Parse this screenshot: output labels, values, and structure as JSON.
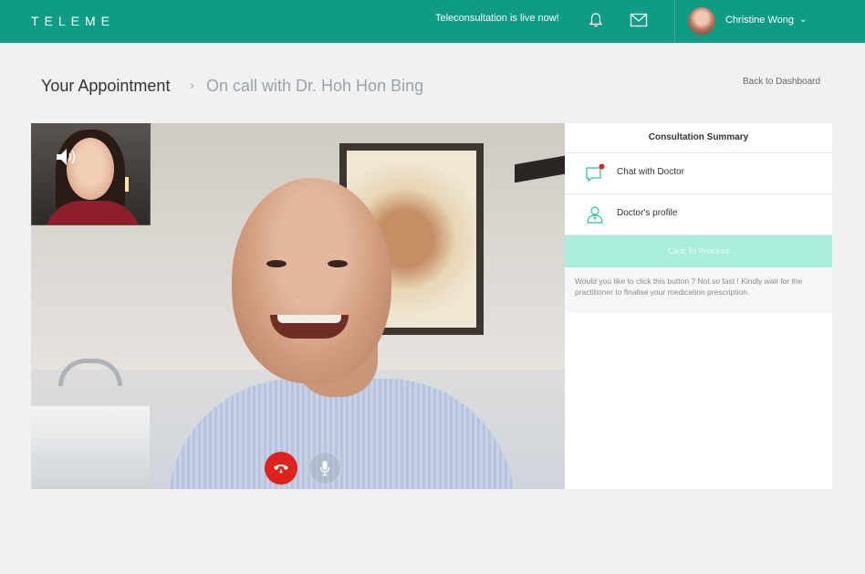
{
  "header": {
    "logo": "TELEME",
    "live_text": "Teleconsultation is live now!",
    "user_name": "Christine Wong",
    "icons": [
      "bell-icon",
      "mail-icon",
      "chevron-down-icon"
    ],
    "brand_color": "#0f9b86"
  },
  "breadcrumb": {
    "main": "Your Appointment",
    "separator": "›",
    "sub": "On call with Dr. Hoh Hon Bing"
  },
  "back_link": "Back to Dashboard",
  "video": {
    "controls": [
      "end-call-icon",
      "microphone-icon"
    ],
    "speaker_icon": "speaker-icon"
  },
  "panel": {
    "title": "Consultation Summary",
    "items": [
      {
        "label": "Chat with Doctor",
        "icon": "chat-icon"
      },
      {
        "label": "Doctor's profile",
        "icon": "doctor-profile-icon"
      }
    ],
    "proceed_label": "Click To Proceed",
    "proceed_note": "Would you like to click this button ? Not so fast ! Kindly wait for the practitioner to finalise your medication prescription.",
    "accent_color": "#a9eedb"
  }
}
